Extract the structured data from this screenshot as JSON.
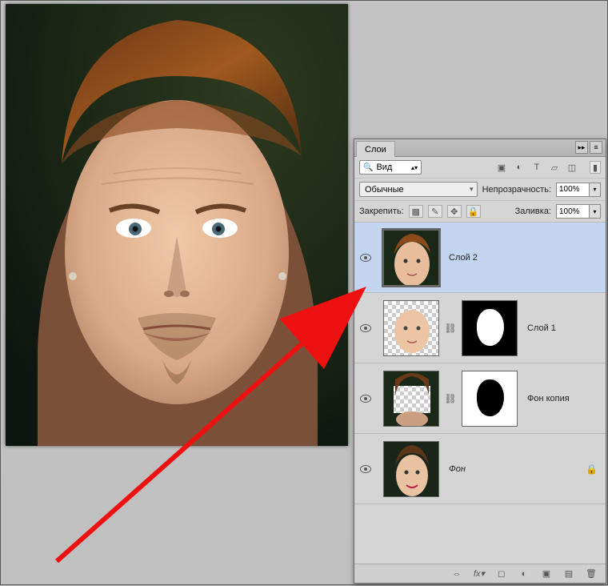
{
  "panel": {
    "tab_title": "Слои",
    "search_label": "Вид",
    "blend_mode": "Обычные",
    "opacity_label": "Непрозрачность:",
    "opacity_value": "100%",
    "lock_label": "Закрепить:",
    "fill_label": "Заливка:",
    "fill_value": "100%",
    "filter_icons": [
      "image-filter-icon",
      "adjust-filter-icon",
      "type-filter-icon",
      "shape-filter-icon",
      "smart-filter-icon"
    ]
  },
  "layers": [
    {
      "name": "Слой 2",
      "selected": true,
      "has_mask": false,
      "mask_style": null,
      "italic": false,
      "locked": false,
      "thumb": "full-face"
    },
    {
      "name": "Слой 1",
      "selected": false,
      "has_mask": true,
      "mask_style": "black-white",
      "italic": false,
      "locked": false,
      "thumb": "face-only-checker"
    },
    {
      "name": "Фон копия",
      "selected": false,
      "has_mask": true,
      "mask_style": "white-black",
      "italic": false,
      "locked": false,
      "thumb": "hair-checker"
    },
    {
      "name": "Фон",
      "selected": false,
      "has_mask": false,
      "mask_style": null,
      "italic": true,
      "locked": true,
      "thumb": "woman-face"
    }
  ],
  "footer_icons": [
    "link-icon",
    "fx-icon",
    "mask-icon",
    "adjustment-icon",
    "group-icon",
    "new-layer-icon",
    "trash-icon"
  ]
}
